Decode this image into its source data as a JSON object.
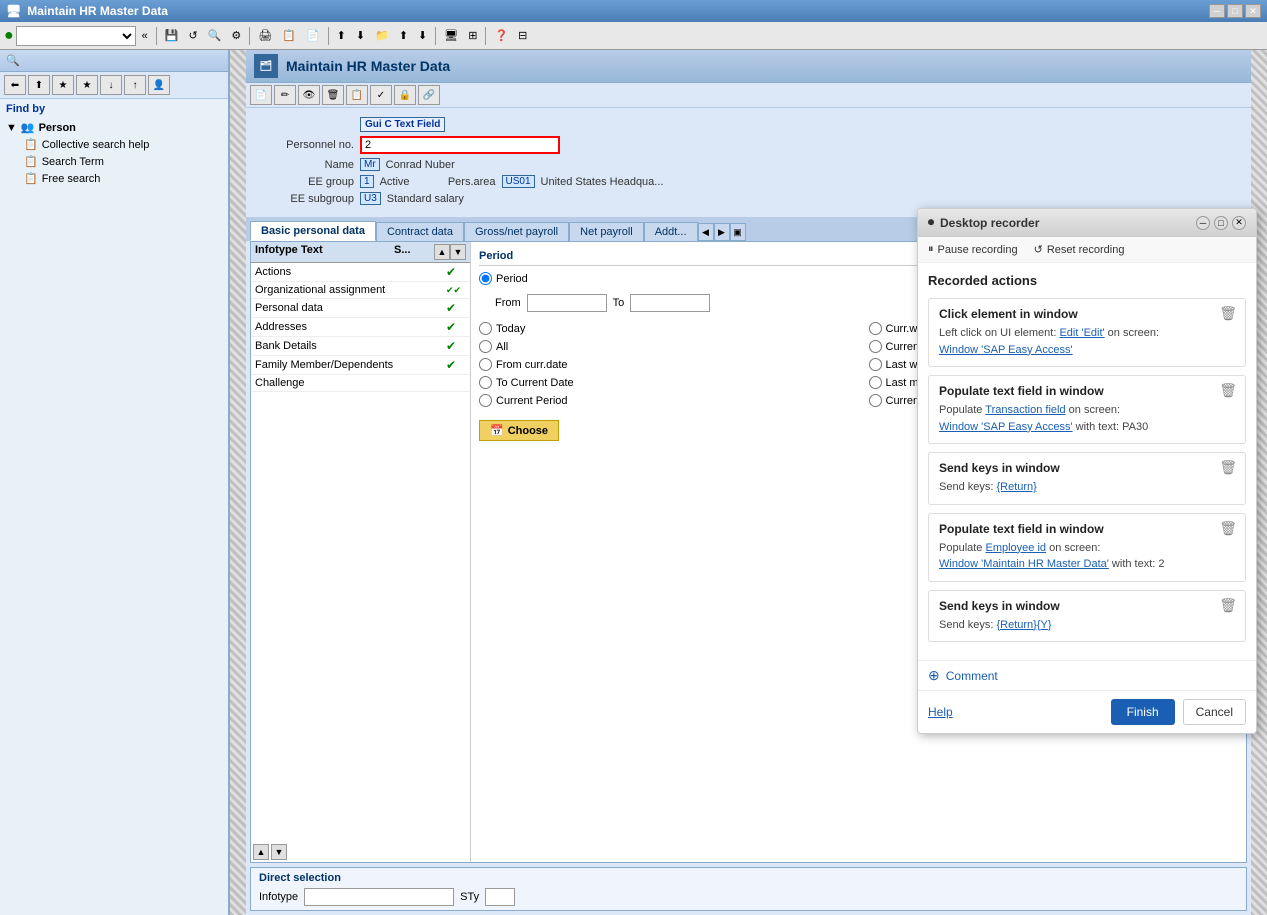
{
  "titlebar": {
    "title": "Maintain HR Master Data",
    "minimize": "─",
    "maximize": "□",
    "close": "✕"
  },
  "toolbar": {
    "combo_placeholder": "",
    "nav_back": "«",
    "buttons": [
      "💾",
      "🔄",
      "🔍",
      "⚙",
      "📋",
      "📄",
      "📁",
      "🖨",
      "📎",
      "✂",
      "📌",
      "❓",
      "📊"
    ]
  },
  "app": {
    "title": "Maintain HR Master Data",
    "icon_label": "HR"
  },
  "sidebar": {
    "find_by_label": "Find by",
    "items": [
      {
        "label": "Person",
        "type": "parent",
        "expanded": true
      },
      {
        "label": "Collective search help",
        "type": "child"
      },
      {
        "label": "Search Term",
        "type": "child"
      },
      {
        "label": "Free search",
        "type": "child"
      }
    ]
  },
  "form": {
    "personnel_no_label": "Personnel no.",
    "personnel_no_value": "2",
    "field_popup_label": "Gui C Text Field",
    "name_label": "Name",
    "name_prefix": "Mr",
    "name_value": "Conrad Nuber",
    "ee_group_label": "EE group",
    "ee_group_value": "1",
    "ee_group_status": "Active",
    "pers_area_label": "Pers.area",
    "pers_area_code": "US01",
    "pers_area_name": "United States Headqua...",
    "ee_subgroup_label": "EE subgroup",
    "ee_subgroup_value": "U3",
    "ee_subgroup_status": "Standard salary"
  },
  "tabs": {
    "items": [
      {
        "label": "Basic personal data",
        "active": true
      },
      {
        "label": "Contract data"
      },
      {
        "label": "Gross/net payroll"
      },
      {
        "label": "Net payroll"
      },
      {
        "label": "Addt..."
      }
    ]
  },
  "infotype_table": {
    "col1": "Infotype Text",
    "col2": "S...",
    "rows": [
      {
        "text": "Actions",
        "status": "✔",
        "extra": ""
      },
      {
        "text": "Organizational assignment",
        "status": "✔✔",
        "extra": ""
      },
      {
        "text": "Personal data",
        "status": "✔",
        "extra": ""
      },
      {
        "text": "Addresses",
        "status": "✔",
        "extra": ""
      },
      {
        "text": "Bank Details",
        "status": "✔",
        "extra": ""
      },
      {
        "text": "Family Member/Dependents",
        "status": "✔",
        "extra": ""
      },
      {
        "text": "Challenge",
        "status": "",
        "extra": ""
      }
    ]
  },
  "period": {
    "title": "Period",
    "period_label": "Period",
    "from_label": "From",
    "to_label": "To",
    "today_label": "Today",
    "curr_week_label": "Curr.week",
    "all_label": "All",
    "current_month_label": "Current month",
    "from_curr_date_label": "From curr.date",
    "last_week_label": "Last week",
    "to_current_date_label": "To Current Date",
    "last_month_label": "Last month",
    "current_period_label": "Current Period",
    "current_year_label": "Current Year",
    "choose_btn": "Choose"
  },
  "direct_selection": {
    "title": "Direct selection",
    "infotype_label": "Infotype",
    "sty_label": "STy"
  },
  "recorder": {
    "title": "Desktop recorder",
    "icon": "⏺",
    "pause_label": "Pause recording",
    "reset_label": "Reset recording",
    "section_title": "Recorded actions",
    "actions": [
      {
        "id": 1,
        "title": "Click element in window",
        "description": "Left click on UI element: ",
        "link1": "Edit 'Edit'",
        "mid_text": " on screen:",
        "link2": "Window 'SAP Easy Access'"
      },
      {
        "id": 2,
        "title": "Populate text field in window",
        "description": "Populate ",
        "link1": "Transaction field",
        "mid_text": " on screen:",
        "link2": "Window 'SAP Easy Access'",
        "suffix": " with text: ",
        "value": "PA30"
      },
      {
        "id": 3,
        "title": "Send keys in window",
        "description": "Send keys: ",
        "link1": "{Return}"
      },
      {
        "id": 4,
        "title": "Populate text field in window",
        "description": "Populate ",
        "link1": "Employee id",
        "mid_text": " on screen:",
        "link2": "Window 'Maintain HR Master Data'",
        "suffix": " with text: ",
        "value": "2"
      },
      {
        "id": 5,
        "title": "Send keys in window",
        "description": "Send keys: ",
        "link1": "{Return}{Y}"
      }
    ],
    "comment_label": "Comment",
    "help_label": "Help",
    "finish_label": "Finish",
    "cancel_label": "Cancel"
  }
}
